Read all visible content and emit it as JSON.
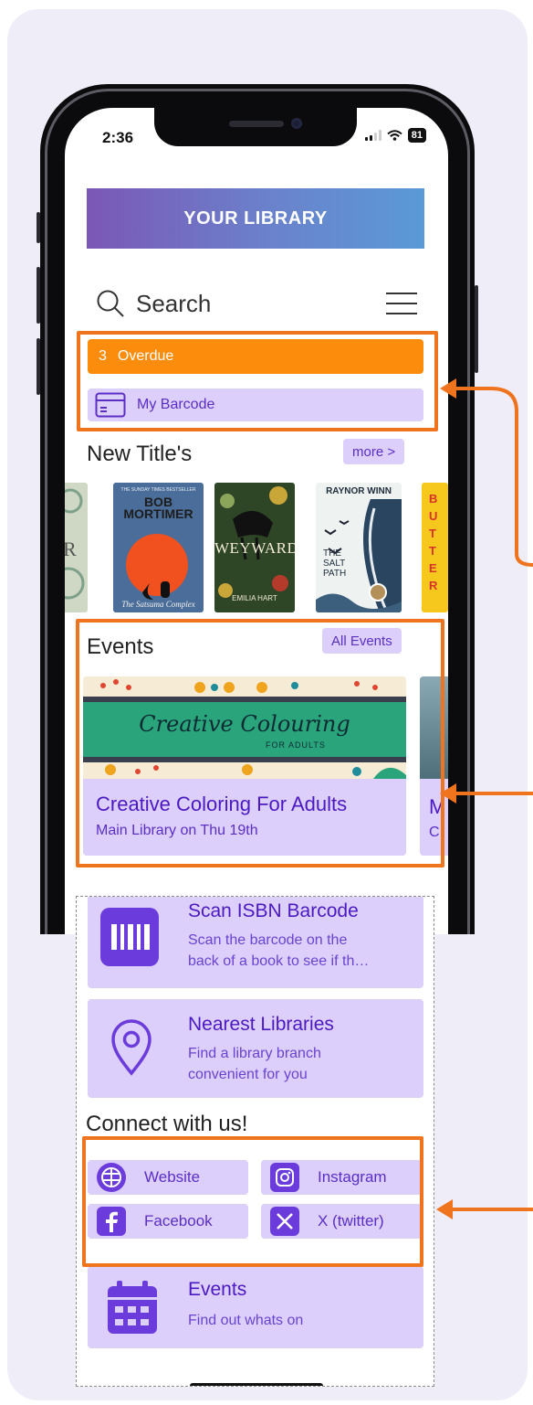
{
  "status_bar": {
    "time": "2:36",
    "battery": "81"
  },
  "banner": {
    "title": "YOUR LIBRARY"
  },
  "search": {
    "label": "Search"
  },
  "overdue": {
    "count": "3",
    "label": "Overdue"
  },
  "barcode": {
    "label": "My Barcode"
  },
  "new_titles": {
    "heading": "New Title's",
    "more_label": "more >",
    "books": [
      {
        "title_lines": [
          "BOB",
          "MORTIMER"
        ],
        "top_line": "THE SUNDAY TIMES BESTSELLER",
        "subtitle": "The Satsuma Complex"
      },
      {
        "title_lines": [
          "WEYWARD"
        ],
        "subtitle": "EMILIA HART"
      },
      {
        "title_lines": [
          "RAYNOR WINN"
        ],
        "subtitle": "THE SALT PATH"
      },
      {
        "title_lines": [
          "BUTTER"
        ]
      }
    ]
  },
  "events": {
    "heading": "Events",
    "all_label": "All Events",
    "items": [
      {
        "image_title": "Creative Colouring",
        "image_subtitle": "FOR ADULTS",
        "title": "Creative Coloring For Adults",
        "subtitle": "Main Library on Thu 19th"
      }
    ]
  },
  "features": [
    {
      "title": "Scan ISBN Barcode",
      "line1": "Scan the barcode on the",
      "line2": "back of a book to see if th…"
    },
    {
      "title": "Nearest Libraries",
      "line1": "Find a library branch",
      "line2": "convenient for you"
    }
  ],
  "connect": {
    "heading": "Connect with us!",
    "links": [
      {
        "label": "Website"
      },
      {
        "label": "Instagram"
      },
      {
        "label": "Facebook"
      },
      {
        "label": "X (twitter)"
      }
    ]
  },
  "events_feature": {
    "title": "Events",
    "subtitle": "Find out whats on"
  },
  "colors": {
    "accent": "#4b19c2",
    "overdue": "#fb8c0c",
    "highlight": "#f0731e",
    "tile": "#dccffb"
  }
}
